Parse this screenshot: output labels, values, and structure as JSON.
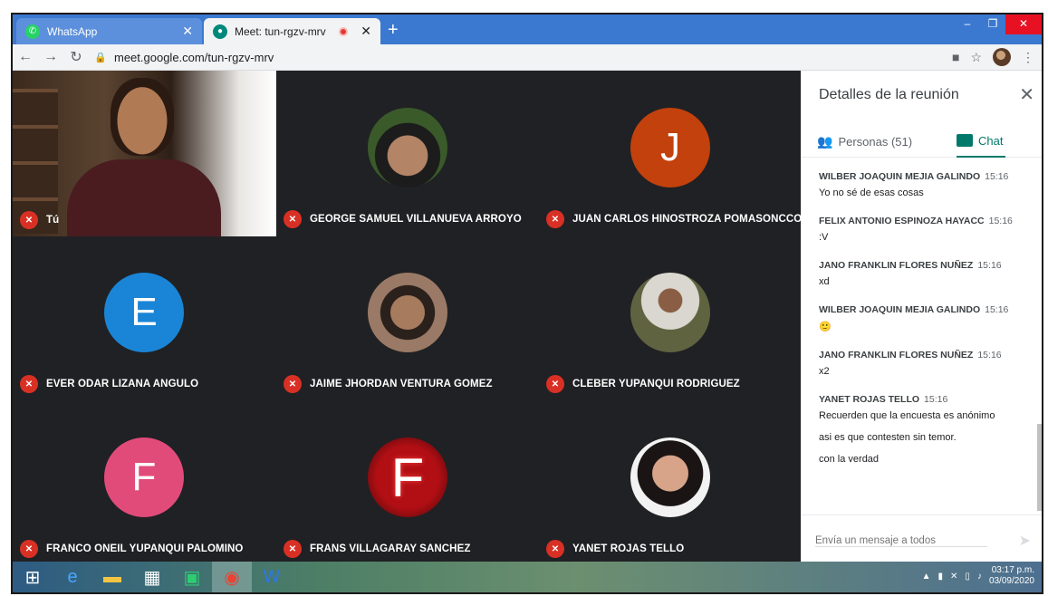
{
  "browser": {
    "tabs": [
      {
        "title": "WhatsApp",
        "active": false
      },
      {
        "title": "Meet: tun-rgzv-mrv",
        "active": true
      }
    ],
    "new_tab": "+",
    "url": "meet.google.com/tun-rgzv-mrv"
  },
  "self": {
    "name": "Tú"
  },
  "participants": [
    {
      "name": "GEORGE SAMUEL VILLANUEVA ARROYO",
      "avatar": "photo",
      "color": "#5b3a2a"
    },
    {
      "name": "JUAN CARLOS HINOSTROZA POMASONCCO",
      "avatar": "letter",
      "letter": "J",
      "color": "#c2410c"
    },
    {
      "name": "EVER ODAR LIZANA ANGULO",
      "avatar": "letter",
      "letter": "E",
      "color": "#1a85d6"
    },
    {
      "name": "JAIME JHORDAN VENTURA GOMEZ",
      "avatar": "photo",
      "color": "#8a6c55"
    },
    {
      "name": "CLEBER YUPANQUI RODRIGUEZ",
      "avatar": "photo",
      "color": "#6b6a4a"
    },
    {
      "name": "FRANCO ONEIL YUPANQUI PALOMINO",
      "avatar": "letter",
      "letter": "F",
      "color": "#e14b7a"
    },
    {
      "name": "FRANS VILLAGARAY SANCHEZ",
      "avatar": "letter-neon",
      "letter": "F",
      "color": "#b10f14"
    },
    {
      "name": "YANET ROJAS TELLO",
      "avatar": "photo",
      "color": "#3a2a2a"
    }
  ],
  "panel": {
    "title": "Detalles de la reunión",
    "people_tab": "Personas (51)",
    "chat_tab": "Chat",
    "compose_placeholder": "Envía un mensaje a todos",
    "messages": [
      {
        "sender": "WILBER JOAQUIN MEJIA GALINDO",
        "time": "15:16",
        "lines": [
          "Yo no sé  de esas cosas"
        ]
      },
      {
        "sender": "FELIX ANTONIO ESPINOZA HAYACC",
        "time": "15:16",
        "lines": [
          ":V"
        ]
      },
      {
        "sender": "JANO FRANKLIN FLORES NUÑEZ",
        "time": "15:16",
        "lines": [
          "xd"
        ]
      },
      {
        "sender": "WILBER JOAQUIN MEJIA GALINDO",
        "time": "15:16",
        "lines": [
          "🙂"
        ]
      },
      {
        "sender": "JANO FRANKLIN FLORES NUÑEZ",
        "time": "15:16",
        "lines": [
          "x2"
        ]
      },
      {
        "sender": "YANET ROJAS TELLO",
        "time": "15:16",
        "lines": [
          "Recuerden que la encuesta es anónimo",
          "asi es que contesten sin temor.",
          "con la verdad"
        ]
      }
    ]
  },
  "taskbar": {
    "time": "03:17 p.m.",
    "date": "03/09/2020"
  }
}
